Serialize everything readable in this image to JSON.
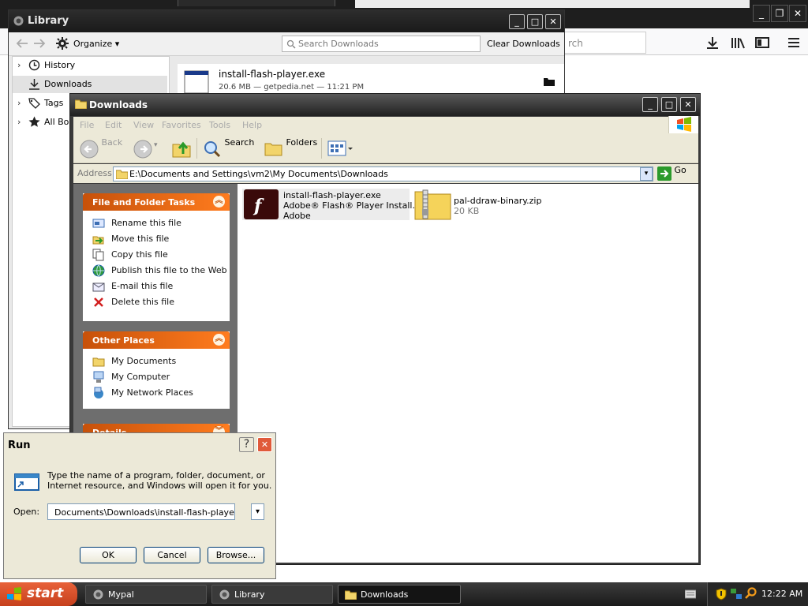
{
  "browser": {
    "search_placeholder": "rch",
    "win_min": "_",
    "win_restore": "❐",
    "win_close": "✕"
  },
  "library": {
    "title": "Library",
    "organize_label": "Organize",
    "search_placeholder": "Search Downloads",
    "clear_label": "Clear Downloads",
    "sidebar": [
      {
        "label": "History",
        "icon": "clock-icon"
      },
      {
        "label": "Downloads",
        "icon": "download-arrow-icon"
      },
      {
        "label": "Tags",
        "icon": "tag-icon"
      },
      {
        "label": "All Book",
        "icon": "star-icon"
      }
    ],
    "download": {
      "name": "install-flash-player.exe",
      "meta": "20.6 MB — getpedia.net — 11:21 PM"
    }
  },
  "explorer": {
    "title": "Downloads",
    "menu": [
      "File",
      "Edit",
      "View",
      "Favorites",
      "Tools",
      "Help"
    ],
    "back_label": "Back",
    "search_label": "Search",
    "folders_label": "Folders",
    "address_label": "Address",
    "address_value": "E:\\Documents and Settings\\vm2\\My Documents\\Downloads",
    "go_label": "Go",
    "file_tasks_title": "File and Folder Tasks",
    "file_tasks": [
      {
        "label": "Rename this file",
        "icon": "rename-icon"
      },
      {
        "label": "Move this file",
        "icon": "move-icon"
      },
      {
        "label": "Copy this file",
        "icon": "copy-icon"
      },
      {
        "label": "Publish this file to the Web",
        "icon": "globe-icon"
      },
      {
        "label": "E-mail this file",
        "icon": "email-icon"
      },
      {
        "label": "Delete this file",
        "icon": "delete-x-icon"
      }
    ],
    "other_places_title": "Other Places",
    "other_places": [
      {
        "label": "My Documents",
        "icon": "folder-icon"
      },
      {
        "label": "My Computer",
        "icon": "computer-icon"
      },
      {
        "label": "My Network Places",
        "icon": "network-icon"
      }
    ],
    "details_title": "Details",
    "files": [
      {
        "name": "install-flash-player.exe",
        "line2": "Adobe® Flash® Player Install...",
        "line3": "Adobe",
        "icon": "flash-icon"
      },
      {
        "name": "pal-ddraw-binary.zip",
        "line2": "20 KB",
        "icon": "zip-folder-icon"
      }
    ]
  },
  "run": {
    "title": "Run",
    "help": "?",
    "description_line1": "Type the name of a program, folder, document, or",
    "description_line2": "Internet resource, and Windows will open it for you.",
    "open_label": "Open:",
    "open_value": "Documents\\Downloads\\install-flash-player.exe\" />",
    "ok": "OK",
    "cancel": "Cancel",
    "browse": "Browse..."
  },
  "taskbar": {
    "start": "start",
    "buttons": [
      {
        "label": "Mypal",
        "active": false
      },
      {
        "label": "Library",
        "active": false
      },
      {
        "label": "Downloads",
        "active": true
      }
    ],
    "clock": "12:22 AM"
  }
}
